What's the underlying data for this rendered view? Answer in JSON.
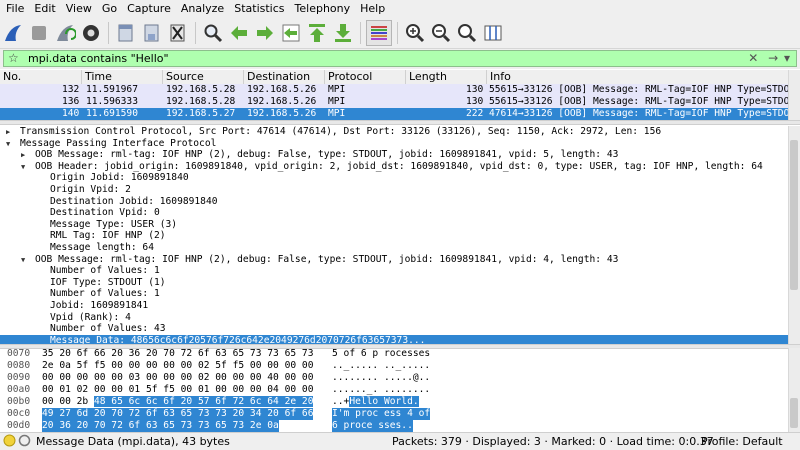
{
  "menu": [
    "File",
    "Edit",
    "View",
    "Go",
    "Capture",
    "Analyze",
    "Statistics",
    "Telephony",
    "Help"
  ],
  "toolbar_icons": [
    "shark-fin-start-icon",
    "stop-capture-icon",
    "restart-capture-icon",
    "capture-options-icon",
    "open-file-icon",
    "save-file-icon",
    "close-file-icon",
    "find-packet-icon",
    "go-back-icon",
    "go-forward-icon",
    "go-to-packet-icon",
    "first-packet-icon",
    "last-packet-icon",
    "colorize-icon",
    "zoom-in-icon",
    "zoom-out-icon",
    "normal-size-icon",
    "resize-columns-icon"
  ],
  "filter": {
    "value": "mpi.data contains \"Hello\"",
    "clear_glyph": "✕",
    "apply_glyph": "→",
    "dropdown_glyph": "▾",
    "bookmark_glyph": "☆"
  },
  "packet_list": {
    "columns": [
      "No.",
      "Time",
      "Source",
      "Destination",
      "Protocol",
      "Length",
      "Info"
    ],
    "rows": [
      {
        "no": "132",
        "time": "11.591967",
        "src": "192.168.5.28",
        "dst": "192.168.5.26",
        "proto": "MPI",
        "len": "130",
        "info": "55615→33126 [OOB] Message: RML-Tag=IOF HNP Type=STDO…"
      },
      {
        "no": "136",
        "time": "11.596333",
        "src": "192.168.5.28",
        "dst": "192.168.5.26",
        "proto": "MPI",
        "len": "130",
        "info": "55615→33126 [OOB] Message: RML-Tag=IOF HNP Type=STDO…"
      },
      {
        "no": "140",
        "time": "11.691590",
        "src": "192.168.5.27",
        "dst": "192.168.5.26",
        "proto": "MPI",
        "len": "222",
        "info": "47614→33126 [OOB] Message: RML-Tag=IOF HNP Type=STDO…"
      }
    ]
  },
  "details": [
    {
      "indent": 0,
      "arrow": "right",
      "text": "Transmission Control Protocol, Src Port: 47614 (47614), Dst Port: 33126 (33126), Seq: 1150, Ack: 2972, Len: 156"
    },
    {
      "indent": 0,
      "arrow": "down",
      "text": "Message Passing Interface Protocol"
    },
    {
      "indent": 1,
      "arrow": "right",
      "text": "OOB Message: rml-tag: IOF HNP (2), debug: False, type: STDOUT, jobid: 1609891841, vpid: 5, length: 43"
    },
    {
      "indent": 1,
      "arrow": "down",
      "text": "OOB Header: jobid_origin: 1609891840, vpid_origin: 2, jobid_dst: 1609891840, vpid_dst: 0, type: USER, tag: IOF HNP, length: 64"
    },
    {
      "indent": 2,
      "arrow": "",
      "text": "Origin Jobid: 1609891840"
    },
    {
      "indent": 2,
      "arrow": "",
      "text": "Origin Vpid: 2"
    },
    {
      "indent": 2,
      "arrow": "",
      "text": "Destination Jobid: 1609891840"
    },
    {
      "indent": 2,
      "arrow": "",
      "text": "Destination Vpid: 0"
    },
    {
      "indent": 2,
      "arrow": "",
      "text": "Message Type: USER (3)"
    },
    {
      "indent": 2,
      "arrow": "",
      "text": "RML Tag: IOF HNP (2)"
    },
    {
      "indent": 2,
      "arrow": "",
      "text": "Message length: 64"
    },
    {
      "indent": 1,
      "arrow": "down",
      "text": "OOB Message: rml-tag: IOF HNP (2), debug: False, type: STDOUT, jobid: 1609891841, vpid: 4, length: 43"
    },
    {
      "indent": 2,
      "arrow": "",
      "text": "Number of Values: 1"
    },
    {
      "indent": 2,
      "arrow": "",
      "text": "IOF Type: STDOUT (1)"
    },
    {
      "indent": 2,
      "arrow": "",
      "text": "Number of Values: 1"
    },
    {
      "indent": 2,
      "arrow": "",
      "text": "Jobid: 1609891841"
    },
    {
      "indent": 2,
      "arrow": "",
      "text": "Vpid (Rank): 4"
    },
    {
      "indent": 2,
      "arrow": "",
      "text": "Number of Values: 43"
    },
    {
      "indent": 2,
      "arrow": "",
      "text": "Message Data: 48656c6c6f20576f726c642e2049276d2070726f63657373...",
      "selected": true
    }
  ],
  "hex": [
    {
      "off": "0070",
      "bytes": "35 20 6f 66 20 36 20 70   72 6f 63 65 73 73 65 73",
      "ascii": "5 of 6 p rocesses"
    },
    {
      "off": "0080",
      "bytes": "2e 0a 5f f5 00 00 00 00   00 02 5f f5 00 00 00 00",
      "ascii": ".._..... .._....."
    },
    {
      "off": "0090",
      "bytes": "00 00 00 00 00 03 00 00   00 02 00 00 00 40 00 00",
      "ascii": "........ .....@.."
    },
    {
      "off": "00a0",
      "bytes": "00 01 02 00 00 01 5f f5   00 01 00 00 00 04 00 00",
      "ascii": "......_. ........"
    },
    {
      "off": "00b0",
      "pre": "00 00 2b ",
      "hl": "48 65 6c 6c 6f  20 57 6f 72 6c 64 2e 20",
      "ascii_pre": "..+",
      "ascii_hl": "Hello  World. "
    },
    {
      "off": "00c0",
      "hl": "49 27 6d 20 70 72 6f 63   65 73 73 20 34 20 6f 66",
      "ascii_hl": "I'm proc ess 4 of"
    },
    {
      "off": "00d0",
      "hl": "20 36 20 70 72 6f 63 65   73 73 65 73 2e 0a",
      "ascii_hl": " 6 proce sses.."
    }
  ],
  "status": {
    "message": "Message Data (mpi.data), 43 bytes",
    "packets": "Packets: 379 · Displayed: 3 · Marked: 0 · Load time: 0:0.37",
    "profile": "Profile: Default"
  }
}
